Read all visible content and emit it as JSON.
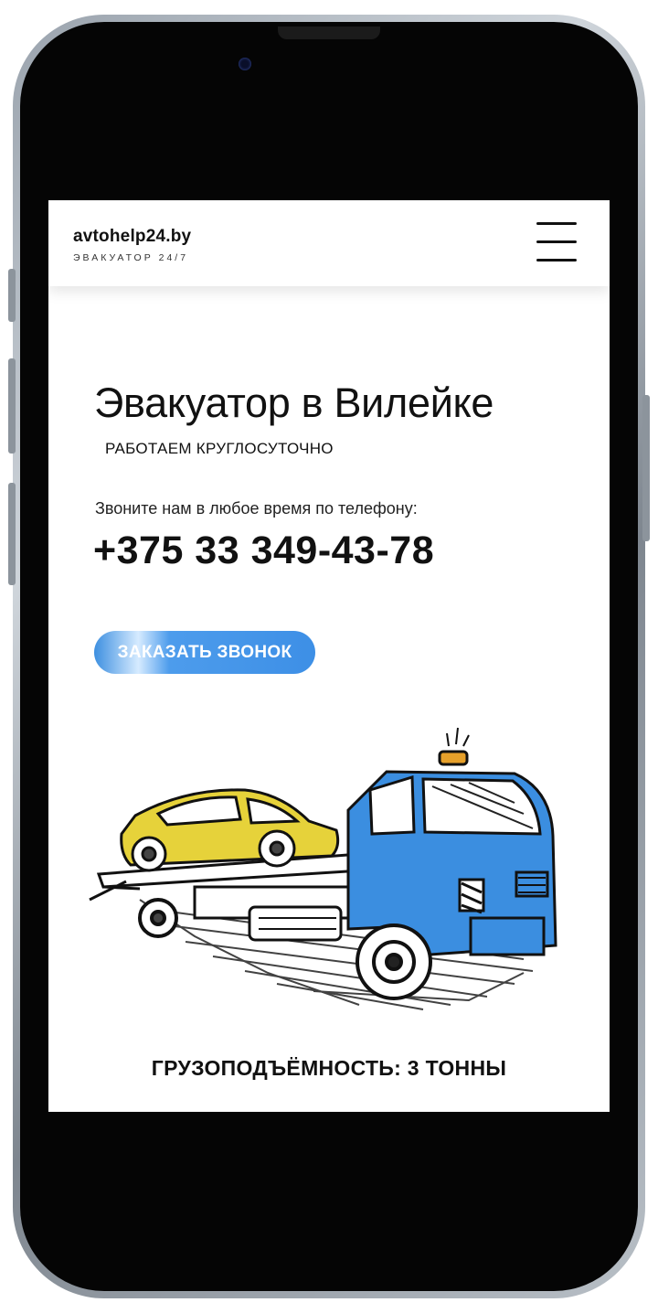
{
  "header": {
    "brand_name": "avtohelp24.by",
    "brand_tagline": "ЭВАКУАТОР 24/7"
  },
  "hero": {
    "title": "Эвакуатор в Вилейке",
    "subtitle": "РАБОТАЕМ КРУГЛОСУТОЧНО",
    "call_text": "Звоните нам в любое время по телефону:",
    "phone": "+375 33 349-43-78",
    "callback_label": "ЗАКАЗАТЬ ЗВОНОК"
  },
  "capacity_label": "ГРУЗОПОДЪЁМНОСТЬ: 3 ТОННЫ",
  "colors": {
    "accent_blue": "#3d8fe6",
    "truck_blue": "#3b8ee0",
    "car_yellow": "#e6d23a",
    "text": "#111111"
  },
  "icons": {
    "menu": "hamburger-icon"
  }
}
